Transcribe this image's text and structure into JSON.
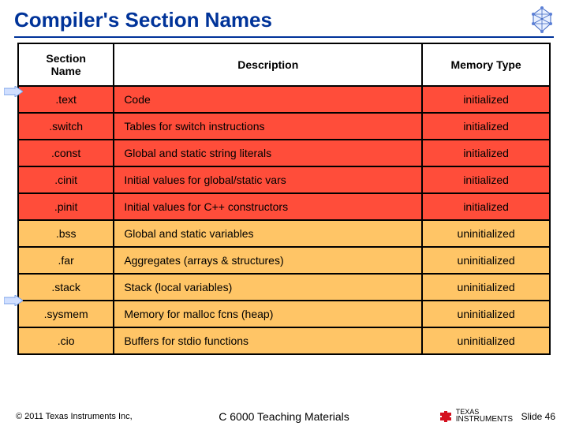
{
  "title": "Compiler's Section Names",
  "headers": {
    "name": "Section\nName",
    "desc": "Description",
    "mem": "Memory Type"
  },
  "rows": [
    {
      "name": ".text",
      "desc": "Code",
      "mem": "initialized",
      "cls": "init"
    },
    {
      "name": ".switch",
      "desc": "Tables for switch instructions",
      "mem": "initialized",
      "cls": "init"
    },
    {
      "name": ".const",
      "desc": "Global and static string literals",
      "mem": "initialized",
      "cls": "init"
    },
    {
      "name": ".cinit",
      "desc": "Initial values for global/static vars",
      "mem": "initialized",
      "cls": "init"
    },
    {
      "name": ".pinit",
      "desc": "Initial values for C++ constructors",
      "mem": "initialized",
      "cls": "init"
    },
    {
      "name": ".bss",
      "desc": "Global and static variables",
      "mem": "uninitialized",
      "cls": "uninit"
    },
    {
      "name": ".far",
      "desc": "Aggregates (arrays & structures)",
      "mem": "uninitialized",
      "cls": "uninit"
    },
    {
      "name": ".stack",
      "desc": "Stack (local variables)",
      "mem": "uninitialized",
      "cls": "uninit"
    },
    {
      "name": ".sysmem",
      "desc": "Memory for malloc fcns (heap)",
      "mem": "uninitialized",
      "cls": "uninit"
    },
    {
      "name": ".cio",
      "desc": "Buffers for stdio functions",
      "mem": "uninitialized",
      "cls": "uninit"
    }
  ],
  "footer": {
    "copyright": "© 2011 Texas Instruments Inc,",
    "center": "C 6000 Teaching Materials",
    "ti_line1": "TEXAS",
    "ti_line2": "INSTRUMENTS",
    "slide": "Slide 46"
  },
  "chart_data": {
    "type": "table",
    "title": "Compiler's Section Names",
    "columns": [
      "Section Name",
      "Description",
      "Memory Type"
    ],
    "rows": [
      [
        ".text",
        "Code",
        "initialized"
      ],
      [
        ".switch",
        "Tables for switch instructions",
        "initialized"
      ],
      [
        ".const",
        "Global and static string literals",
        "initialized"
      ],
      [
        ".cinit",
        "Initial values for global/static vars",
        "initialized"
      ],
      [
        ".pinit",
        "Initial values for C++ constructors",
        "initialized"
      ],
      [
        ".bss",
        "Global and static variables",
        "uninitialized"
      ],
      [
        ".far",
        "Aggregates (arrays & structures)",
        "uninitialized"
      ],
      [
        ".stack",
        "Stack (local variables)",
        "uninitialized"
      ],
      [
        ".sysmem",
        "Memory for malloc fcns (heap)",
        "uninitialized"
      ],
      [
        ".cio",
        "Buffers for stdio functions",
        "uninitialized"
      ]
    ]
  }
}
